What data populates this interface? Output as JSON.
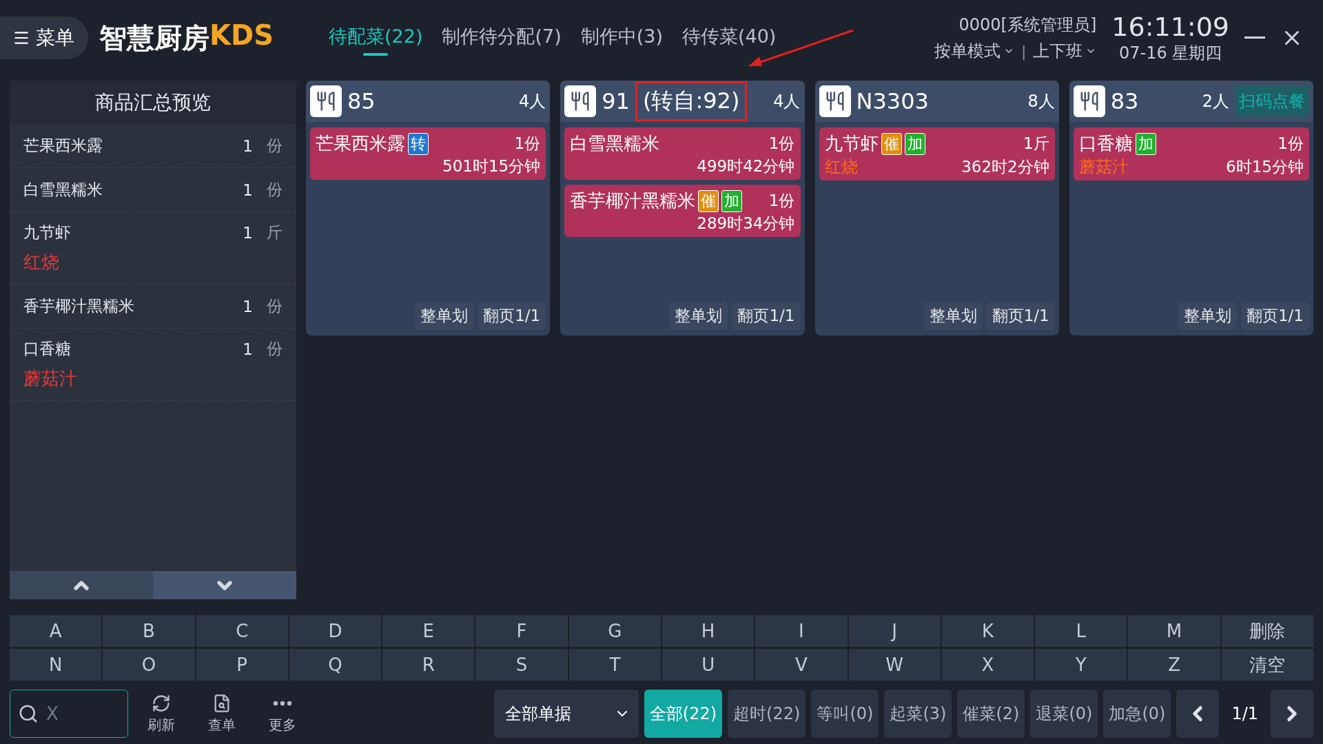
{
  "menu_button": {
    "label": "菜单"
  },
  "logo": {
    "text": "智慧厨房",
    "accent": "KDS"
  },
  "tabs": [
    {
      "label": "待配菜(22)",
      "selected": true
    },
    {
      "label": "制作待分配(7)",
      "selected": false
    },
    {
      "label": "制作中(3)",
      "selected": false
    },
    {
      "label": "待传菜(40)",
      "selected": false
    }
  ],
  "user": "0000[系统管理员]",
  "mode_menu": "按单模式",
  "separator": "|",
  "shift_menu": "上下班",
  "time": "16:11:09",
  "date": "07-16 星期四",
  "summary": {
    "title": "商品汇总预览",
    "items": [
      {
        "name": "芒果西米露",
        "qty": "1",
        "unit": "份"
      },
      {
        "name": "白雪黑糯米",
        "qty": "1",
        "unit": "份"
      },
      {
        "name": "九节虾",
        "qty": "1",
        "unit": "斤",
        "note": "红烧"
      },
      {
        "name": "香芋椰汁黑糯米",
        "qty": "1",
        "unit": "份"
      },
      {
        "name": "口香糖",
        "qty": "1",
        "unit": "份",
        "note": "蘑菇汁"
      }
    ]
  },
  "orders": [
    {
      "table": "85",
      "guests": "4人",
      "items": [
        {
          "name": "芒果西米露",
          "tags": [
            {
              "label": "转",
              "kind": "transfer"
            }
          ],
          "qty": "1份",
          "elapsed": "501时15分钟"
        }
      ],
      "actions": [
        "整单划",
        "翻页1/1"
      ]
    },
    {
      "table": "91",
      "transfer": "(转自:92)",
      "highlighted": true,
      "guests": "4人",
      "items": [
        {
          "name": "白雪黑糯米",
          "qty": "1份",
          "elapsed": "499时42分钟"
        },
        {
          "name": "香芋椰汁黑糯米",
          "tags": [
            {
              "label": "催",
              "kind": "urge"
            },
            {
              "label": "加",
              "kind": "add"
            }
          ],
          "qty": "1份",
          "elapsed": "289时34分钟"
        }
      ],
      "actions": [
        "整单划",
        "翻页1/1"
      ]
    },
    {
      "table": "N3303",
      "guests": "8人",
      "items": [
        {
          "name": "九节虾",
          "tags": [
            {
              "label": "催",
              "kind": "urge"
            },
            {
              "label": "加",
              "kind": "add"
            }
          ],
          "qty": "1斤",
          "note": "红烧",
          "elapsed": "362时2分钟"
        }
      ],
      "actions": [
        "整单划",
        "翻页1/1"
      ]
    },
    {
      "table": "83",
      "guests": "2人",
      "source": "扫码点餐",
      "items": [
        {
          "name": "口香糖",
          "tags": [
            {
              "label": "加",
              "kind": "add"
            }
          ],
          "qty": "1份",
          "note": "蘑菇汁",
          "elapsed": "6时15分钟"
        }
      ],
      "actions": [
        "整单划",
        "翻页1/1"
      ]
    }
  ],
  "keyboard": [
    [
      "A",
      "B",
      "C",
      "D",
      "E",
      "F",
      "G",
      "H",
      "I",
      "J",
      "K",
      "L",
      "M",
      "删除"
    ],
    [
      "N",
      "O",
      "P",
      "Q",
      "R",
      "S",
      "T",
      "U",
      "V",
      "W",
      "X",
      "Y",
      "Z",
      "清空"
    ]
  ],
  "search": {
    "placeholder": "X"
  },
  "tools": [
    {
      "label": "刷新",
      "kind": "refresh"
    },
    {
      "label": "查单",
      "kind": "lookup"
    },
    {
      "label": "更多",
      "kind": "more"
    }
  ],
  "doc_filter": "全部单据",
  "filters": [
    {
      "label": "全部(22)",
      "selected": true
    },
    {
      "label": "超时(22)",
      "selected": false
    },
    {
      "label": "等叫(0)",
      "selected": false
    },
    {
      "label": "起菜(3)",
      "selected": false
    },
    {
      "label": "催菜(2)",
      "selected": false
    },
    {
      "label": "退菜(0)",
      "selected": false
    },
    {
      "label": "加急(0)",
      "selected": false
    }
  ],
  "pager": "1/1"
}
